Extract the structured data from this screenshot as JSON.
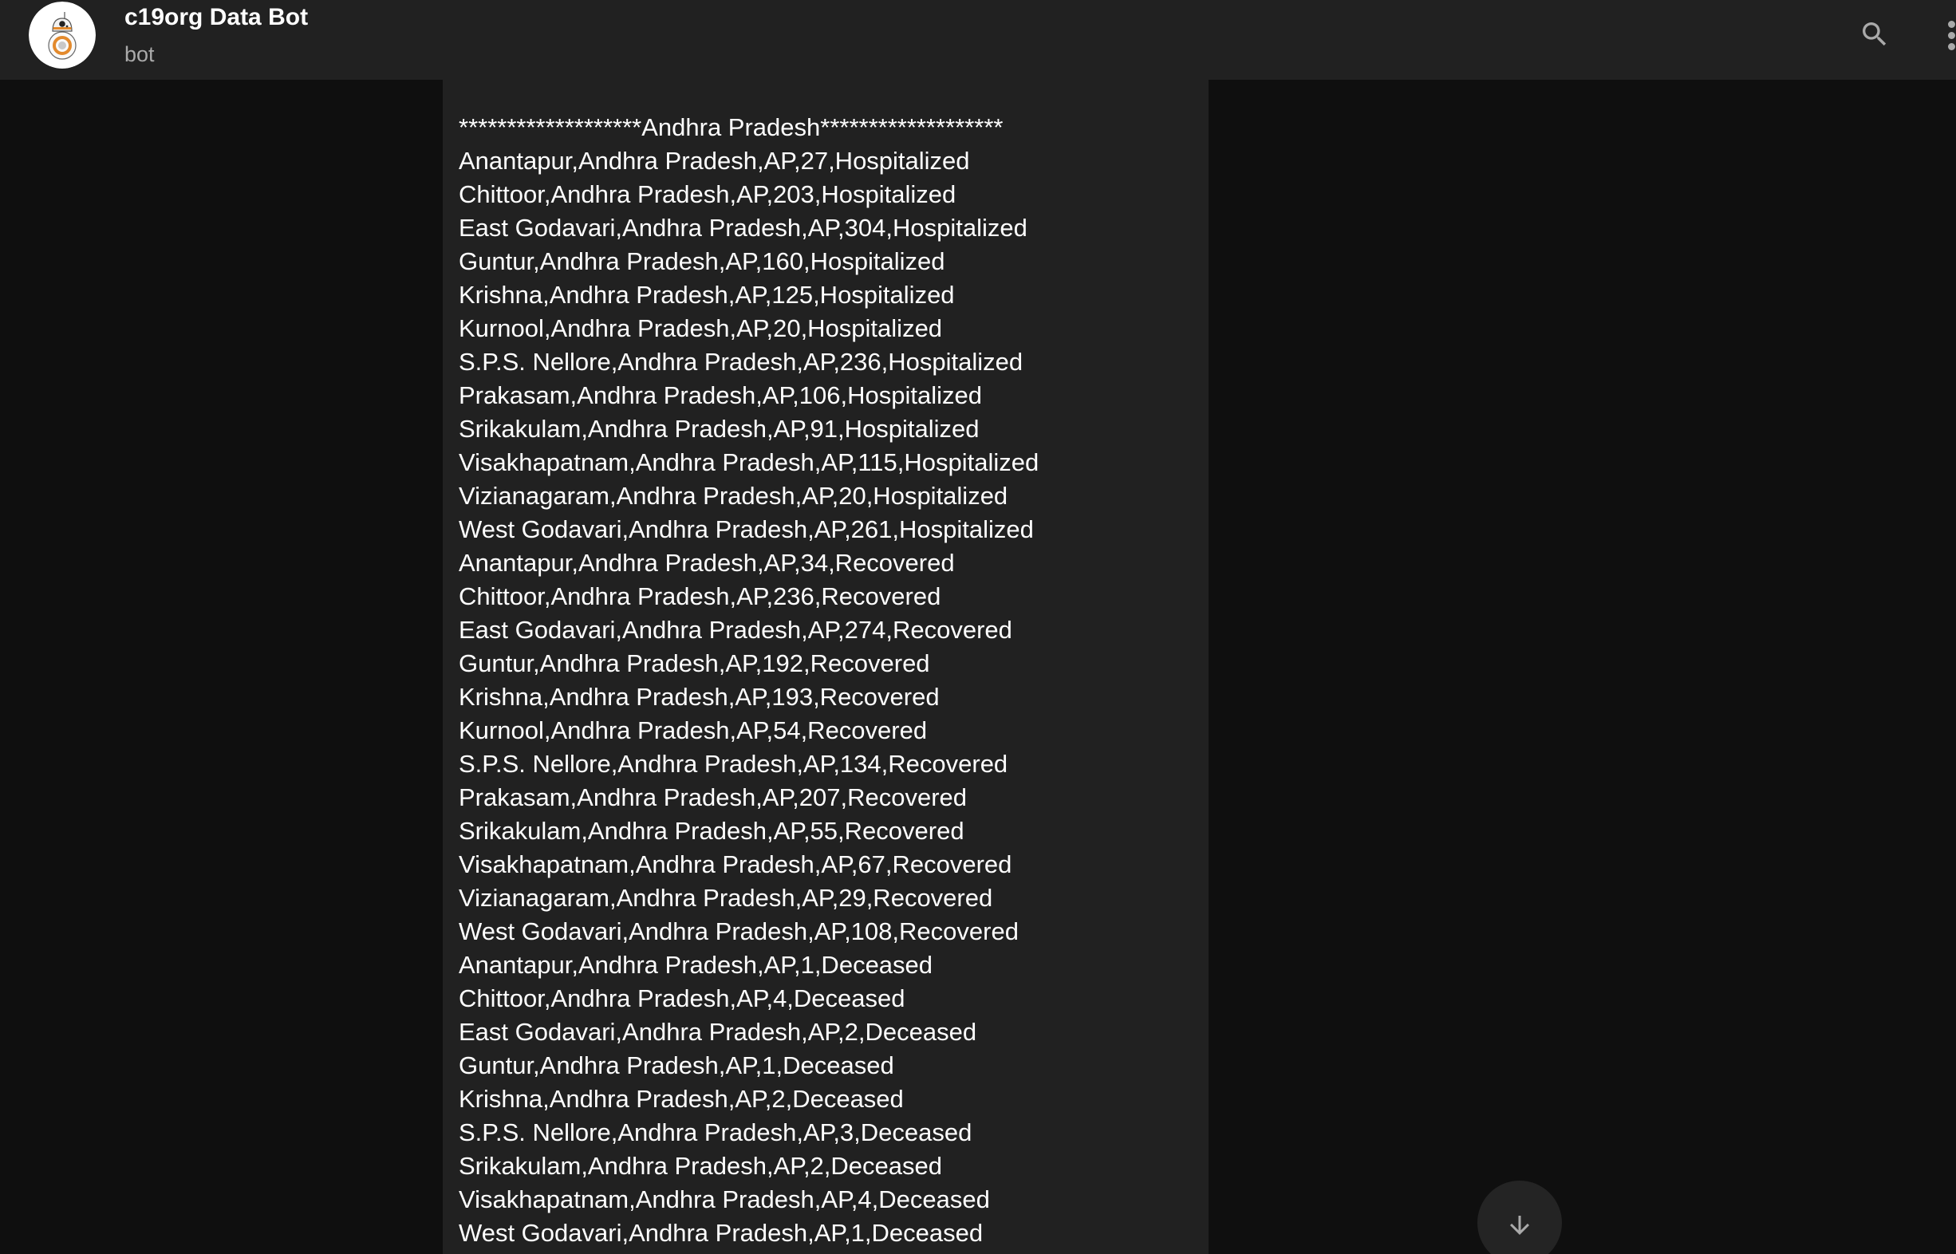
{
  "header": {
    "title": "c19org Data Bot",
    "subtitle": "bot"
  },
  "icons": {
    "avatar": "bb8-droid-avatar-icon",
    "search": "search-icon",
    "menu": "more-vert-icon",
    "scroll_down": "arrow-down-icon"
  },
  "colors": {
    "header_bg": "#212121",
    "chat_bg": "#0f0f0f",
    "message_bg": "#212121",
    "text": "#ffffff",
    "secondary_text": "#aaaaaa",
    "avatar_accent": "#e38a2d"
  },
  "message": {
    "lines": [
      "*******************Andhra Pradesh*******************",
      "Anantapur,Andhra Pradesh,AP,27,Hospitalized",
      "Chittoor,Andhra Pradesh,AP,203,Hospitalized",
      "East Godavari,Andhra Pradesh,AP,304,Hospitalized",
      "Guntur,Andhra Pradesh,AP,160,Hospitalized",
      "Krishna,Andhra Pradesh,AP,125,Hospitalized",
      "Kurnool,Andhra Pradesh,AP,20,Hospitalized",
      "S.P.S. Nellore,Andhra Pradesh,AP,236,Hospitalized",
      "Prakasam,Andhra Pradesh,AP,106,Hospitalized",
      "Srikakulam,Andhra Pradesh,AP,91,Hospitalized",
      "Visakhapatnam,Andhra Pradesh,AP,115,Hospitalized",
      "Vizianagaram,Andhra Pradesh,AP,20,Hospitalized",
      "West Godavari,Andhra Pradesh,AP,261,Hospitalized",
      "Anantapur,Andhra Pradesh,AP,34,Recovered",
      "Chittoor,Andhra Pradesh,AP,236,Recovered",
      "East Godavari,Andhra Pradesh,AP,274,Recovered",
      "Guntur,Andhra Pradesh,AP,192,Recovered",
      "Krishna,Andhra Pradesh,AP,193,Recovered",
      "Kurnool,Andhra Pradesh,AP,54,Recovered",
      "S.P.S. Nellore,Andhra Pradesh,AP,134,Recovered",
      "Prakasam,Andhra Pradesh,AP,207,Recovered",
      "Srikakulam,Andhra Pradesh,AP,55,Recovered",
      "Visakhapatnam,Andhra Pradesh,AP,67,Recovered",
      "Vizianagaram,Andhra Pradesh,AP,29,Recovered",
      "West Godavari,Andhra Pradesh,AP,108,Recovered",
      "Anantapur,Andhra Pradesh,AP,1,Deceased",
      "Chittoor,Andhra Pradesh,AP,4,Deceased",
      "East Godavari,Andhra Pradesh,AP,2,Deceased",
      "Guntur,Andhra Pradesh,AP,1,Deceased",
      "Krishna,Andhra Pradesh,AP,2,Deceased",
      "S.P.S. Nellore,Andhra Pradesh,AP,3,Deceased",
      "Srikakulam,Andhra Pradesh,AP,2,Deceased",
      "Visakhapatnam,Andhra Pradesh,AP,4,Deceased",
      "West Godavari,Andhra Pradesh,AP,1,Deceased"
    ]
  }
}
